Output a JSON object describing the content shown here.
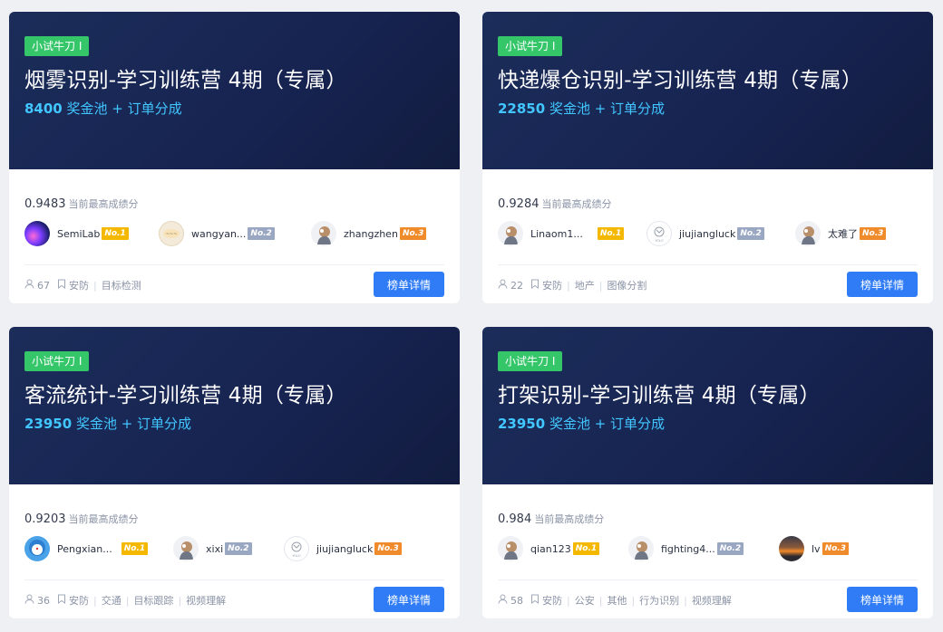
{
  "cards": [
    {
      "tag": "小试牛刀 Ⅰ",
      "title": "烟雾识别-学习训练营 4期（专属）",
      "prize_amount": "8400",
      "prize_text": " 奖金池 + 订单分成",
      "score": "0.9483",
      "score_label": "当前最高成绩分",
      "rankers": [
        {
          "name": "SemiLab",
          "badge": "No.1",
          "avatar": "galaxy"
        },
        {
          "name": "wangyan...",
          "badge": "No.2",
          "avatar": "beige-logo"
        },
        {
          "name": "zhangzhen",
          "badge": "No.3",
          "avatar": "default-person"
        }
      ],
      "participants": "67",
      "tags": [
        "安防",
        "目标检测"
      ],
      "button": "榜单详情"
    },
    {
      "tag": "小试牛刀 Ⅰ",
      "title": "快递爆仓识别-学习训练营 4期（专属）",
      "prize_amount": "22850",
      "prize_text": " 奖金池 + 订单分成",
      "score": "0.9284",
      "score_label": "当前最高成绩分",
      "rankers": [
        {
          "name": "Linaom1...",
          "badge": "No.1",
          "avatar": "default-person"
        },
        {
          "name": "jiujiangluck",
          "badge": "No.2",
          "avatar": "circle-logo"
        },
        {
          "name": "太难了",
          "badge": "No.3",
          "avatar": "default-person"
        }
      ],
      "participants": "22",
      "tags": [
        "安防",
        "地产",
        "图像分割"
      ],
      "button": "榜单详情"
    },
    {
      "tag": "小试牛刀 Ⅰ",
      "title": "客流统计-学习训练营 4期（专属）",
      "prize_amount": "23950",
      "prize_text": " 奖金池 + 订单分成",
      "score": "0.9203",
      "score_label": "当前最高成绩分",
      "rankers": [
        {
          "name": "Pengxian...",
          "badge": "No.1",
          "avatar": "cartoon"
        },
        {
          "name": "xixi",
          "badge": "No.2",
          "avatar": "default-person"
        },
        {
          "name": "jiujiangluck",
          "badge": "No.3",
          "avatar": "circle-logo"
        }
      ],
      "participants": "36",
      "tags": [
        "安防",
        "交通",
        "目标跟踪",
        "视频理解"
      ],
      "button": "榜单详情"
    },
    {
      "tag": "小试牛刀 Ⅰ",
      "title": "打架识别-学习训练营 4期（专属）",
      "prize_amount": "23950",
      "prize_text": " 奖金池 + 订单分成",
      "score": "0.984",
      "score_label": "当前最高成绩分",
      "rankers": [
        {
          "name": "qian123",
          "badge": "No.1",
          "avatar": "default-person"
        },
        {
          "name": "fighting4...",
          "badge": "No.2",
          "avatar": "default-person"
        },
        {
          "name": "lv",
          "badge": "No.3",
          "avatar": "sunset"
        }
      ],
      "participants": "58",
      "tags": [
        "安防",
        "公安",
        "其他",
        "行为识别",
        "视频理解"
      ],
      "button": "榜单详情"
    }
  ],
  "colors": {
    "banner": "#172452",
    "tag_green": "#35c66a",
    "prize_blue": "#41c6ff",
    "button_blue": "#2f7cf6",
    "badge_gold": "#f5b800",
    "badge_silver": "#9aa7c2",
    "badge_bronze": "#f08b2c"
  }
}
